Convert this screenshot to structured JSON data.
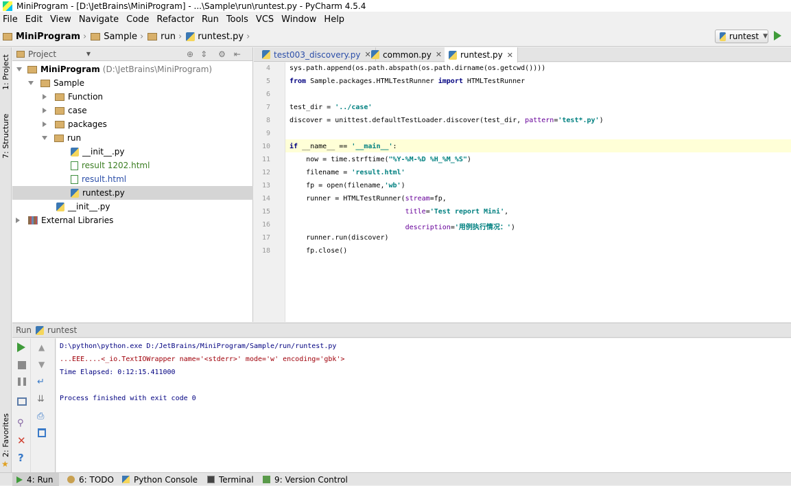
{
  "window": {
    "title": "MiniProgram - [D:\\JetBrains\\MiniProgram] - ...\\Sample\\run\\runtest.py - PyCharm 4.5.4"
  },
  "menu": [
    "File",
    "Edit",
    "View",
    "Navigate",
    "Code",
    "Refactor",
    "Run",
    "Tools",
    "VCS",
    "Window",
    "Help"
  ],
  "breadcrumbs": [
    "MiniProgram",
    "Sample",
    "run",
    "runtest.py"
  ],
  "run_config": "runtest",
  "left_strip": {
    "project": "1: Project",
    "structure": "7: Structure",
    "favorites": "2: Favorites"
  },
  "project_panel": {
    "title": "Project",
    "tree": [
      {
        "label": "MiniProgram",
        "suffix": "(D:\\JetBrains\\MiniProgram)"
      },
      {
        "label": "Sample"
      },
      {
        "label": "Function"
      },
      {
        "label": "case"
      },
      {
        "label": "packages"
      },
      {
        "label": "run"
      },
      {
        "label": "__init__.py"
      },
      {
        "label": "result 1202.html"
      },
      {
        "label": "result.html"
      },
      {
        "label": "runtest.py"
      },
      {
        "label": "__init__.py"
      },
      {
        "label": "External Libraries"
      }
    ]
  },
  "editor": {
    "tabs": [
      "test003_discovery.py",
      "common.py",
      "runtest.py"
    ],
    "line_numbers": [
      "4",
      "5",
      "6",
      "7",
      "8",
      "9",
      "10",
      "11",
      "12",
      "13",
      "14",
      "15",
      "16",
      "17",
      "18"
    ],
    "lines": {
      "l4": "sys.path.append(os.path.abspath(os.path.dirname(os.getcwd())))",
      "l5_kw1": "from",
      "l5_mid": " Sample.packages.HTMLTestRunner ",
      "l5_kw2": "import",
      "l5_end": " HTMLTestRunner",
      "l7_a": "test_dir = ",
      "l7_str": "'../case'",
      "l8_a": "discover = unittest.defaultTestLoader.discover(test_dir, ",
      "l8_prm": "pattern",
      "l8_eq": "=",
      "l8_str": "'test*.py'",
      "l8_end": ")",
      "l10_kw": "if",
      "l10_a": " __name__ == ",
      "l10_str": "'__main__'",
      "l10_end": ":",
      "l11_a": "    now = time.strftime(",
      "l11_str": "\"%Y-%M-%D %H_%M_%S\"",
      "l11_end": ")",
      "l12_a": "    filename = ",
      "l12_str": "'result.html'",
      "l13_a": "    fp = open(filename,",
      "l13_str": "'wb'",
      "l13_end": ")",
      "l14_a": "    runner = HTMLTestRunner(",
      "l14_prm": "stream",
      "l14_end": "=fp,",
      "l15_pad": "                            ",
      "l15_prm": "title",
      "l15_eq": "=",
      "l15_str": "'Test report Mini'",
      "l15_end": ",",
      "l16_pad": "                            ",
      "l16_prm": "description",
      "l16_eq": "=",
      "l16_str": "'用例执行情况：'",
      "l16_end": ")",
      "l17": "    runner.run(discover)",
      "l18": "    fp.close()"
    }
  },
  "run_panel": {
    "label": "Run",
    "config": "runtest",
    "output": [
      "D:\\python\\python.exe D:/JetBrains/MiniProgram/Sample/run/runtest.py",
      "...EEE....<_io.TextIOWrapper name='<stderr>' mode='w' encoding='gbk'>",
      "Time Elapsed: 0:12:15.411000",
      "Process finished with exit code 0"
    ]
  },
  "bottom_tabs": [
    "4: Run",
    "6: TODO",
    "Python Console",
    "Terminal",
    "9: Version Control"
  ],
  "colors": {
    "keyword": "#000080",
    "string": "#008080",
    "param": "#660099",
    "console_text": "#000080",
    "error_text": "#a0000a"
  }
}
